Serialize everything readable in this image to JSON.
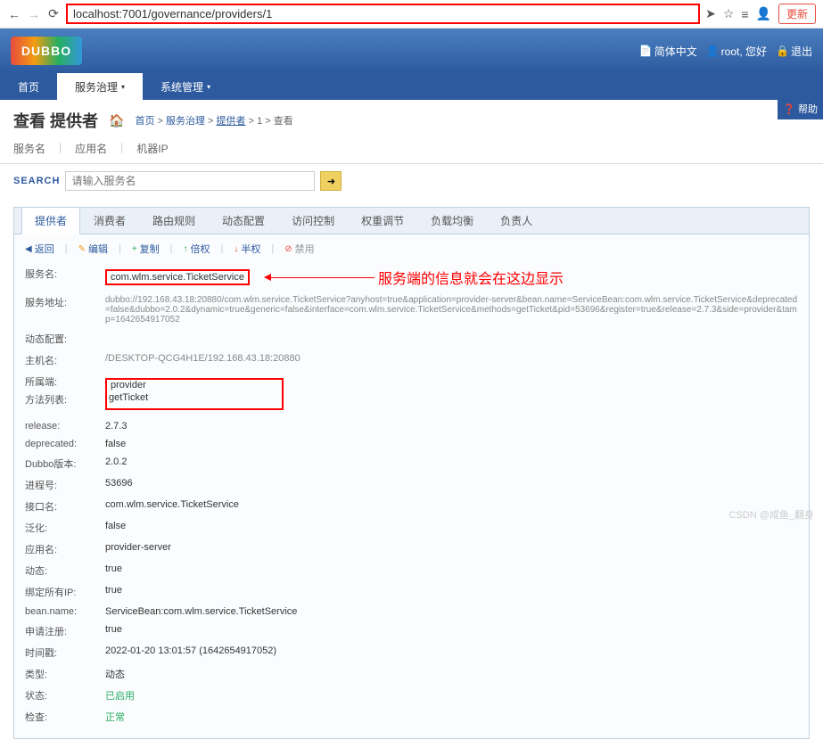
{
  "browser": {
    "url_host": "localhost",
    "url_path": ":7001/governance/providers/1",
    "update_btn": "更新"
  },
  "header": {
    "logo": "DUBBO",
    "simple_cn": "简体中文",
    "user": "root, 您好",
    "logout": "退出"
  },
  "nav": {
    "home": "首页",
    "service_gov": "服务治理",
    "sys_admin": "系统管理"
  },
  "page": {
    "title": "查看 提供者",
    "bc_gov": "服务治理",
    "bc_providers": "提供者",
    "bc_id": "1",
    "bc_view": "查看"
  },
  "subtabs": {
    "service": "服务名",
    "app": "应用名",
    "ip": "机器IP"
  },
  "search": {
    "label": "SEARCH",
    "placeholder": "请输入服务名",
    "btn": "➜"
  },
  "tabs": {
    "provider": "提供者",
    "consumer": "消费者",
    "route": "路由规则",
    "dynconf": "动态配置",
    "access": "访问控制",
    "weight": "权重调节",
    "loadbal": "负载均衡",
    "owner": "负责人"
  },
  "actions": {
    "back": "返回",
    "edit": "编辑",
    "copy": "复制",
    "halve": "倍权",
    "half": "半权",
    "disable": "禁用"
  },
  "annotation": "服务端的信息就会在这边显示",
  "details": {
    "service_name_lbl": "服务名:",
    "service_name_val": "com.wlm.service.TicketService",
    "service_url_lbl": "服务地址:",
    "service_url_val": "dubbo://192.168.43.18:20880/com.wlm.service.TicketService?anyhost=true&application=provider-server&bean.name=ServiceBean:com.wlm.service.TicketService&deprecated=false&dubbo=2.0.2&dynamic=true&generic=false&interface=com.wlm.service.TicketService&methods=getTicket&pid=53696&register=true&release=2.7.3&side=provider&tamp=1642654917052",
    "dynconf_lbl": "动态配置:",
    "host_lbl": "主机名:",
    "host_val": "/DESKTOP-QCG4H1E/192.168.43.18:20880",
    "belong_lbl": "所属端:",
    "belong_val": "provider",
    "methods_lbl": "方法列表:",
    "methods_val": "getTicket",
    "release_lbl": "release:",
    "release_val": "2.7.3",
    "deprecated_lbl": "deprecated:",
    "deprecated_val": "false",
    "dubbover_lbl": "Dubbo版本:",
    "dubbover_val": "2.0.2",
    "pid_lbl": "进程号:",
    "pid_val": "53696",
    "interface_lbl": "接口名:",
    "interface_val": "com.wlm.service.TicketService",
    "generic_lbl": "泛化:",
    "generic_val": "false",
    "app_lbl": "应用名:",
    "app_val": "provider-server",
    "dynamic_lbl": "动态:",
    "dynamic_val": "true",
    "bindip_lbl": "绑定所有IP:",
    "bindip_val": "true",
    "bean_lbl": "bean.name:",
    "bean_val": "ServiceBean:com.wlm.service.TicketService",
    "register_lbl": "申请注册:",
    "register_val": "true",
    "time_lbl": "时间戳:",
    "time_val": "2022-01-20 13:01:57 (1642654917052)",
    "type_lbl": "类型:",
    "type_val": "动态",
    "status_lbl": "状态:",
    "status_val": "已启用",
    "check_lbl": "检查:",
    "check_val": "正常"
  },
  "help": "帮助",
  "watermark": "CSDN @咸鱼_翻身"
}
